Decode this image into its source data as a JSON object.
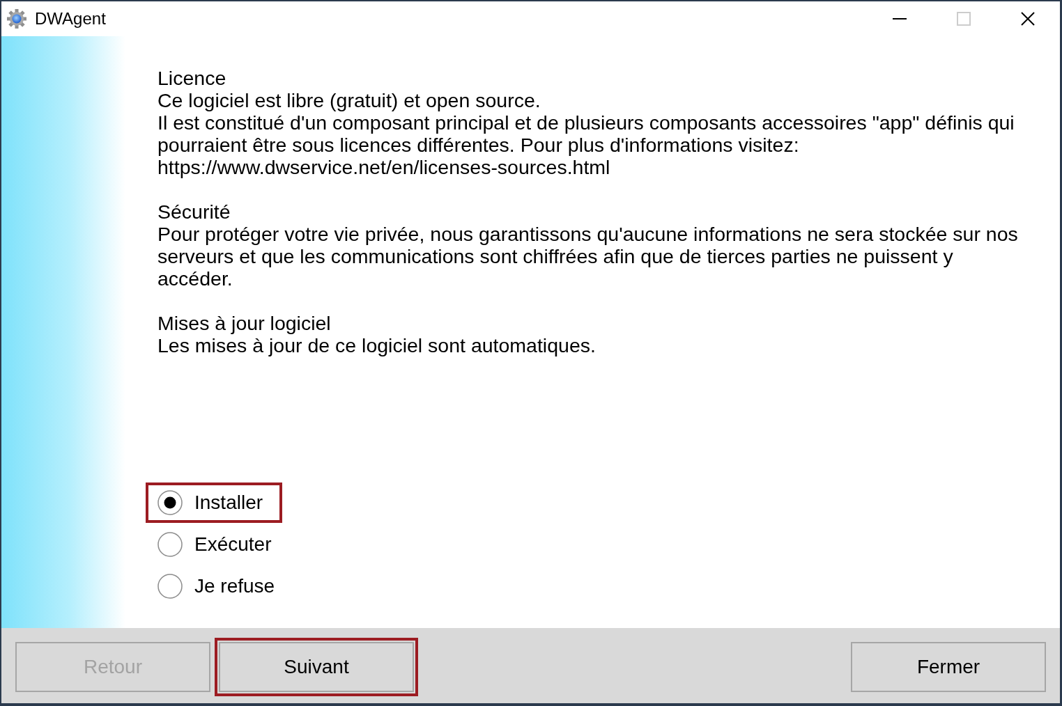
{
  "window": {
    "title": "DWAgent",
    "controls": [
      {
        "kind": "minimize",
        "disabled": false
      },
      {
        "kind": "maximize",
        "disabled": true
      },
      {
        "kind": "close",
        "disabled": false
      }
    ]
  },
  "sections": [
    {
      "heading": "Licence",
      "lines": [
        "Ce logiciel est libre (gratuit) et open source.",
        "Il est constitué d'un composant principal et de plusieurs composants accessoires \"app\" définis qui pourraient être sous licences différentes. Pour plus d'informations visitez:",
        "https://www.dwservice.net/en/licenses-sources.html"
      ]
    },
    {
      "heading": "Sécurité",
      "lines": [
        "Pour protéger votre vie privée, nous garantissons qu'aucune informations ne sera stockée sur nos serveurs et que les communications sont chiffrées afin que de tierces parties ne puissent y accéder."
      ]
    },
    {
      "heading": "Mises à jour logiciel",
      "lines": [
        "Les mises à jour de ce logiciel sont automatiques."
      ]
    }
  ],
  "options": [
    {
      "label": "Installer",
      "selected": true,
      "highlighted": true
    },
    {
      "label": "Exécuter",
      "selected": false,
      "highlighted": false
    },
    {
      "label": "Je refuse",
      "selected": false,
      "highlighted": false
    }
  ],
  "footer": {
    "left_buttons": [
      {
        "label": "Retour",
        "disabled": true,
        "highlighted": false
      },
      {
        "label": "Suivant",
        "disabled": false,
        "highlighted": true
      }
    ],
    "right_buttons": [
      {
        "label": "Fermer",
        "disabled": false,
        "highlighted": false
      }
    ]
  }
}
